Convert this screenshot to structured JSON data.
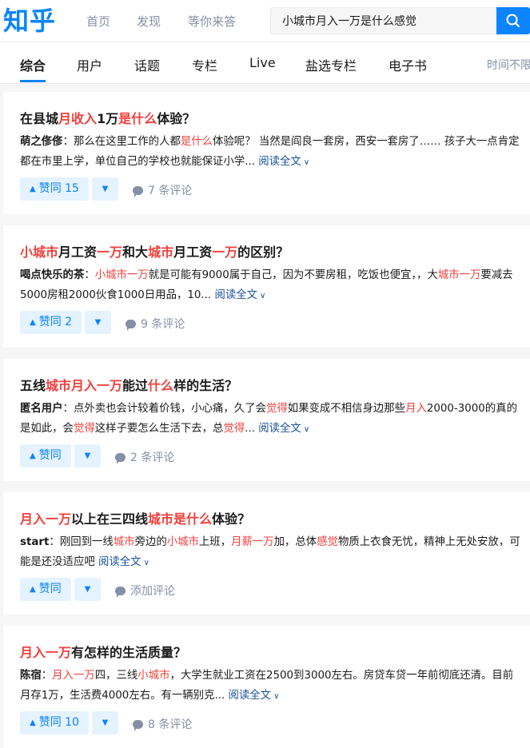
{
  "header": {
    "logo": "知乎",
    "nav": [
      "首页",
      "发现",
      "等你来答"
    ],
    "search_value": "小城市月入一万是什么感觉"
  },
  "tabs": [
    "综合",
    "用户",
    "话题",
    "专栏",
    "Live",
    "盐选专栏",
    "电子书"
  ],
  "time_filter": "时间不限",
  "colors": {
    "brand": "#0a84ff",
    "highlight": "#f1403c",
    "muted": "#8590a6",
    "link": "#175199"
  },
  "results": [
    {
      "title_parts": [
        [
          "在县城",
          0
        ],
        [
          "月收入",
          1
        ],
        [
          "1万",
          0
        ],
        [
          "是什么",
          1
        ],
        [
          "体验？",
          0
        ]
      ],
      "author": "萌之俢俢",
      "line1_parts": [
        [
          "：那么在这里工作的人都",
          0
        ],
        [
          "是什么",
          1
        ],
        [
          "体验呢？ 当然是阎良一套房，西安一套房了…… 孩子大一点肯定",
          0
        ]
      ],
      "line2_parts": [
        [
          "都在市里上学，单位自己的学校也就能保证小学...",
          0
        ]
      ],
      "read_more": "阅读全文",
      "vote_label": "赞同 15",
      "comments": "7 条评论"
    },
    {
      "title_parts": [
        [
          "小城市",
          1
        ],
        [
          "月工资",
          0
        ],
        [
          "一万",
          1
        ],
        [
          "和大",
          0
        ],
        [
          "城市",
          1
        ],
        [
          "月工资",
          0
        ],
        [
          "一万",
          1
        ],
        [
          "的区别？",
          0
        ]
      ],
      "author": "喝点快乐的茶",
      "line1_parts": [
        [
          "：",
          0
        ],
        [
          "小城市一万",
          1
        ],
        [
          "就是可能有9000属于自己，因为不要房租，吃饭也便宜，，大",
          0
        ],
        [
          "城市一万",
          1
        ],
        [
          "要减去",
          0
        ]
      ],
      "line2_parts": [
        [
          "5000房租2000伙食1000日用品，10...",
          0
        ]
      ],
      "read_more": "阅读全文",
      "vote_label": "赞同 2",
      "comments": "9 条评论"
    },
    {
      "title_parts": [
        [
          "五线",
          0
        ],
        [
          "城市月入一万",
          1
        ],
        [
          "能过",
          0
        ],
        [
          "什么",
          1
        ],
        [
          "样的生活？",
          0
        ]
      ],
      "author": "匿名用户",
      "line1_parts": [
        [
          "：点外卖也会计较着价钱，小心痛，久了会",
          0
        ],
        [
          "觉得",
          1
        ],
        [
          "如果变成不相信身边那些",
          0
        ],
        [
          "月入",
          1
        ],
        [
          "2000-3000的真的",
          0
        ]
      ],
      "line2_parts": [
        [
          "是如此，会",
          0
        ],
        [
          "觉得",
          1
        ],
        [
          "这样子要怎么生活下去，总",
          0
        ],
        [
          "觉得",
          1
        ],
        [
          "...",
          0
        ]
      ],
      "read_more": "阅读全文",
      "vote_label": "赞同",
      "comments": "2 条评论"
    },
    {
      "title_parts": [
        [
          "月入一万",
          1
        ],
        [
          "以上在三四线",
          0
        ],
        [
          "城市是什么",
          1
        ],
        [
          "体验？",
          0
        ]
      ],
      "author": "start",
      "line1_parts": [
        [
          "：刚回到一线",
          0
        ],
        [
          "城市",
          1
        ],
        [
          "旁边的",
          0
        ],
        [
          "小城市",
          1
        ],
        [
          "上班，",
          0
        ],
        [
          "月薪一万",
          1
        ],
        [
          "加，总体",
          0
        ],
        [
          "感觉",
          1
        ],
        [
          "物质上衣食无忧，精神上无处安放，可",
          0
        ]
      ],
      "line2_parts": [
        [
          "能是还没适应吧",
          0
        ]
      ],
      "read_more": "阅读全文",
      "vote_label": "赞同",
      "comments": "添加评论"
    },
    {
      "title_parts": [
        [
          "月入一万",
          1
        ],
        [
          "有怎样的生活质量？",
          0
        ]
      ],
      "author": "陈宿",
      "line1_parts": [
        [
          "：",
          0
        ],
        [
          "月入一万",
          1
        ],
        [
          "四，三线",
          0
        ],
        [
          "小城市",
          1
        ],
        [
          "，大学生就业工资在2500到3000左右。房贷车贷一年前彻底还清。目前",
          0
        ]
      ],
      "line2_parts": [
        [
          "月存1万，生活费4000左右。有一辆别克...",
          0
        ]
      ],
      "read_more": "阅读全文",
      "vote_label": "赞同 10",
      "comments": "8 条评论"
    }
  ]
}
